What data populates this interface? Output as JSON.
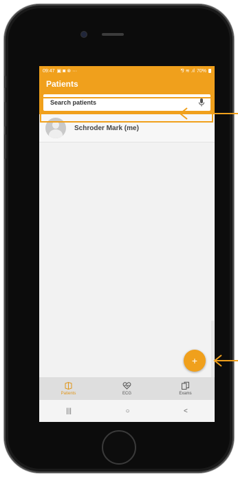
{
  "status_bar": {
    "time": "09:47",
    "notif_icons": "▣ ◙ ⊗ ···",
    "sys_icons": "⅋ ≋ .ıl",
    "battery": "70%"
  },
  "app_bar": {
    "title": "Patients"
  },
  "search": {
    "placeholder": "Search patients",
    "icon": "mic-icon"
  },
  "patients": [
    {
      "name": "Schroder Mark  (me)"
    }
  ],
  "fab": {
    "label": "+"
  },
  "bottom_nav": [
    {
      "label": "Patients",
      "icon": "patients-icon",
      "active": true
    },
    {
      "label": "ECG",
      "icon": "ecg-heart-icon",
      "active": false
    },
    {
      "label": "Exams",
      "icon": "exams-icon",
      "active": false
    }
  ],
  "system_nav": {
    "recents": "|||",
    "home": "○",
    "back": "<"
  },
  "colors": {
    "accent": "#f0a01c",
    "annotation_arrow": "#f0a01c"
  }
}
